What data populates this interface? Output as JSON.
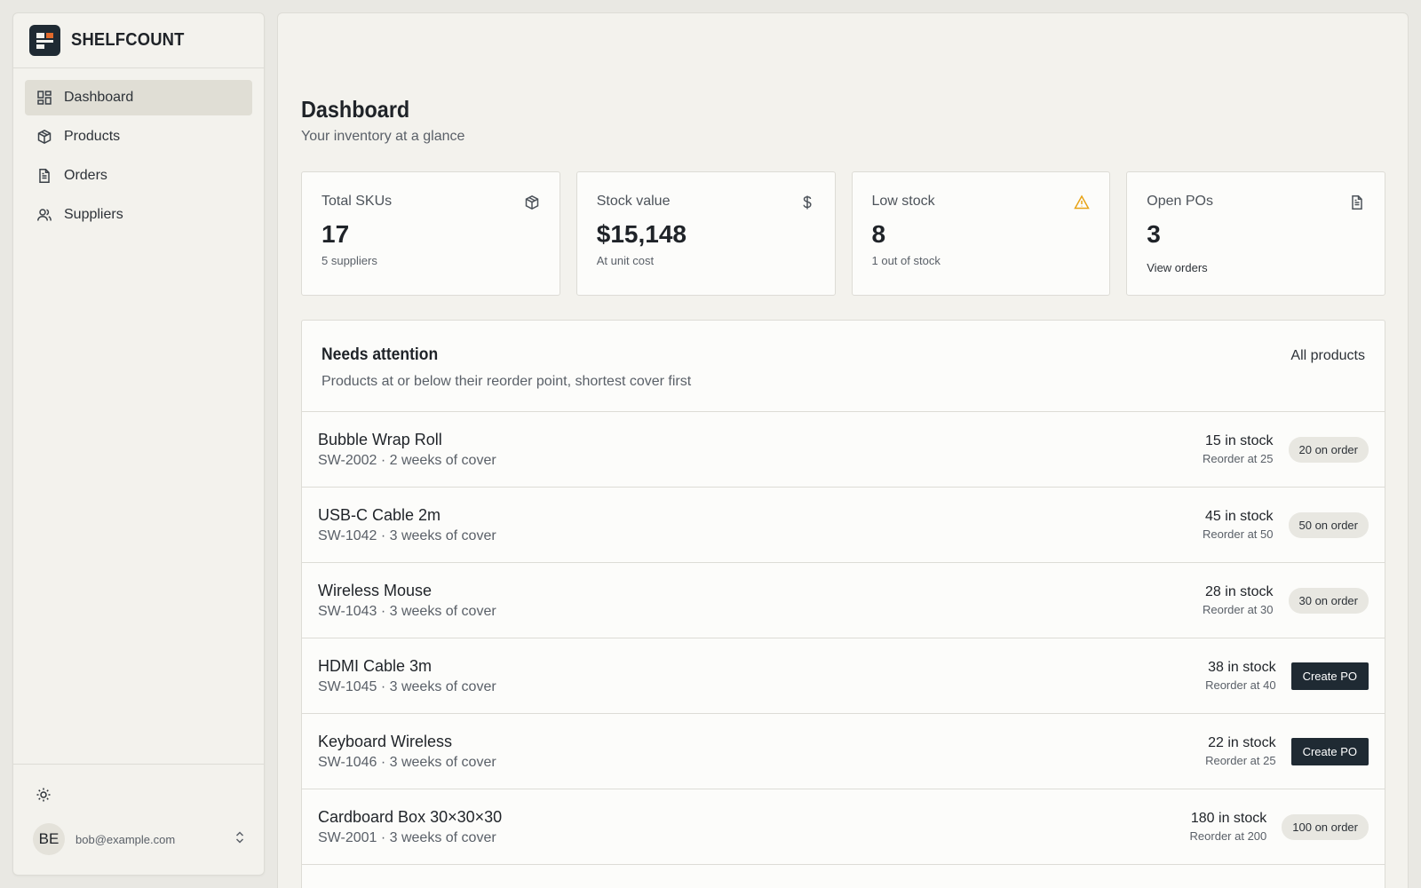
{
  "brand": {
    "name": "SHELFCOUNT"
  },
  "sidebar": {
    "items": [
      {
        "label": "Dashboard",
        "icon": "grid-icon",
        "active": true
      },
      {
        "label": "Products",
        "icon": "box-icon",
        "active": false
      },
      {
        "label": "Orders",
        "icon": "document-icon",
        "active": false
      },
      {
        "label": "Suppliers",
        "icon": "users-icon",
        "active": false
      }
    ],
    "user": {
      "initials": "BE",
      "email": "bob@example.com"
    }
  },
  "page": {
    "title": "Dashboard",
    "subtitle": "Your inventory at a glance"
  },
  "stats": [
    {
      "label": "Total SKUs",
      "value": "17",
      "sub": "5 suppliers",
      "icon": "box-icon"
    },
    {
      "label": "Stock value",
      "value": "$15,148",
      "sub": "At unit cost",
      "icon": "dollar-icon"
    },
    {
      "label": "Low stock",
      "value": "8",
      "sub": "1 out of stock",
      "icon": "warning-icon",
      "icon_color": "#e8a317"
    },
    {
      "label": "Open POs",
      "value": "3",
      "link": "View orders",
      "icon": "document-icon"
    }
  ],
  "attention": {
    "title": "Needs attention",
    "subtitle": "Products at or below their reorder point, shortest cover first",
    "link": "All products",
    "rows": [
      {
        "name": "Bubble Wrap Roll",
        "meta": "SW-2002 · 2 weeks of cover",
        "stock": "15 in stock",
        "reorder": "Reorder at 25",
        "action": "20 on order",
        "action_type": "pill"
      },
      {
        "name": "USB-C Cable 2m",
        "meta": "SW-1042 · 3 weeks of cover",
        "stock": "45 in stock",
        "reorder": "Reorder at 50",
        "action": "50 on order",
        "action_type": "pill"
      },
      {
        "name": "Wireless Mouse",
        "meta": "SW-1043 · 3 weeks of cover",
        "stock": "28 in stock",
        "reorder": "Reorder at 30",
        "action": "30 on order",
        "action_type": "pill"
      },
      {
        "name": "HDMI Cable 3m",
        "meta": "SW-1045 · 3 weeks of cover",
        "stock": "38 in stock",
        "reorder": "Reorder at 40",
        "action": "Create PO",
        "action_type": "button"
      },
      {
        "name": "Keyboard Wireless",
        "meta": "SW-1046 · 3 weeks of cover",
        "stock": "22 in stock",
        "reorder": "Reorder at 25",
        "action": "Create PO",
        "action_type": "button"
      },
      {
        "name": "Cardboard Box 30×30×30",
        "meta": "SW-2001 · 3 weeks of cover",
        "stock": "180 in stock",
        "reorder": "Reorder at 200",
        "action": "100 on order",
        "action_type": "pill"
      }
    ]
  },
  "colors": {
    "accent_dark": "#1f2a33",
    "logo_accent": "#e26a2c",
    "warning": "#e8a317"
  }
}
